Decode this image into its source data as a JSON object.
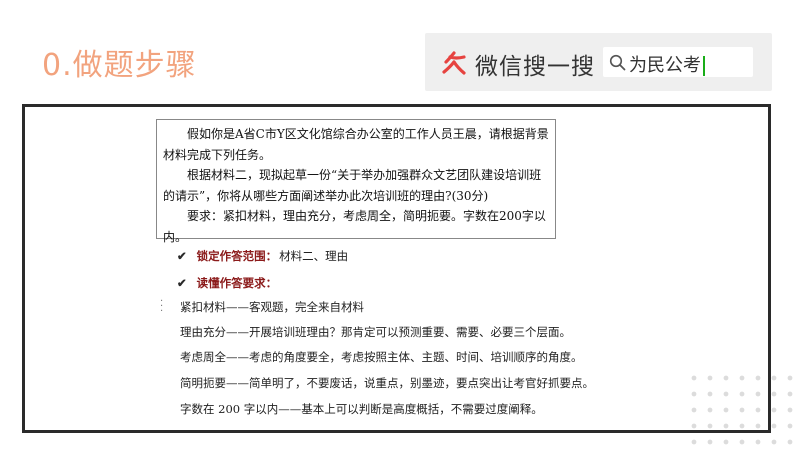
{
  "header": {
    "title": "0.做题步骤"
  },
  "search": {
    "brand": "微信搜一搜",
    "query": "为民公考"
  },
  "question": {
    "paragraphs": [
      "假如你是A省C市Y区文化馆综合办公室的工作人员王晨，请根据背景材料完成下列任务。",
      "根据材料二，现拟起草一份“关于举办加强群众文艺团队建设培训班的请示”，你将从哪些方面阐述举办此次培训班的理由?(30分)",
      "要求：紧扣材料，理由充分，考虑周全，简明扼要。字数在200字以内。"
    ]
  },
  "checks": [
    {
      "label": "锁定作答范围：",
      "value": "材料二、理由"
    },
    {
      "label": "读懂作答要求：",
      "value": ""
    }
  ],
  "requirements": [
    "紧扣材料——客观题，完全来自材料",
    "理由充分——开展培训班理由？那肯定可以预测重要、需要、必要三个层面。",
    "考虑周全——考虑的角度要全，考虑按照主体、主题、时间、培训顺序的角度。",
    "简明扼要——简单明了，不要废话，说重点，别墨迹，要点突出让考官好抓要点。",
    "字数在 200 字以内——基本上可以判断是高度概括，不需要过度阐释。"
  ],
  "colors": {
    "title": "#f2a37e",
    "check_label": "#8b1a1a",
    "wechat_red": "#e64340",
    "caret": "#1aad19"
  }
}
